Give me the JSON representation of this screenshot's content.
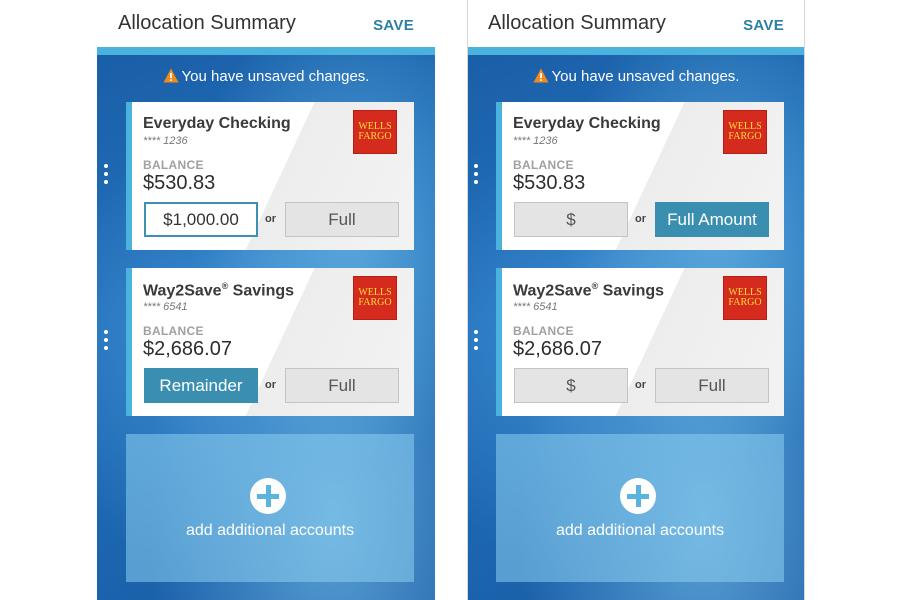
{
  "screens": [
    {
      "header": {
        "title": "Allocation Summary",
        "save_label": "SAVE"
      },
      "warning": "You have unsaved changes.",
      "accounts": [
        {
          "name": "Everyday Checking",
          "number": "**** 1236",
          "balance_label": "BALANCE",
          "balance": "$530.83",
          "amount_value": "$1,000.00",
          "or_label": "or",
          "full_label": "Full"
        },
        {
          "name": "Way2Save",
          "name_mark": "®",
          "name_suffix": " Savings",
          "number": "**** 6541",
          "balance_label": "BALANCE",
          "balance": "$2,686.07",
          "amount_value": "Remainder",
          "or_label": "or",
          "full_label": "Full"
        }
      ],
      "add_label": "add additional accounts"
    },
    {
      "header": {
        "title": "Allocation Summary",
        "save_label": "SAVE"
      },
      "warning": "You have unsaved changes.",
      "accounts": [
        {
          "name": "Everyday Checking",
          "number": "**** 1236",
          "balance_label": "BALANCE",
          "balance": "$530.83",
          "amount_value": "$",
          "or_label": "or",
          "full_label": "Full Amount"
        },
        {
          "name": "Way2Save",
          "name_mark": "®",
          "name_suffix": " Savings",
          "number": "**** 6541",
          "balance_label": "BALANCE",
          "balance": "$2,686.07",
          "amount_value": "$",
          "or_label": "or",
          "full_label": "Full"
        }
      ],
      "add_label": "add additional accounts"
    }
  ],
  "bank_logo": {
    "line1": "WELLS",
    "line2": "FARGO",
    "color": "#d52b1e",
    "text_color": "#ffde38"
  },
  "colors": {
    "accent": "#4ab3dd",
    "save": "#2e7fa4",
    "active_button": "#3a8fb0",
    "warning_icon": "#f28a1b"
  }
}
